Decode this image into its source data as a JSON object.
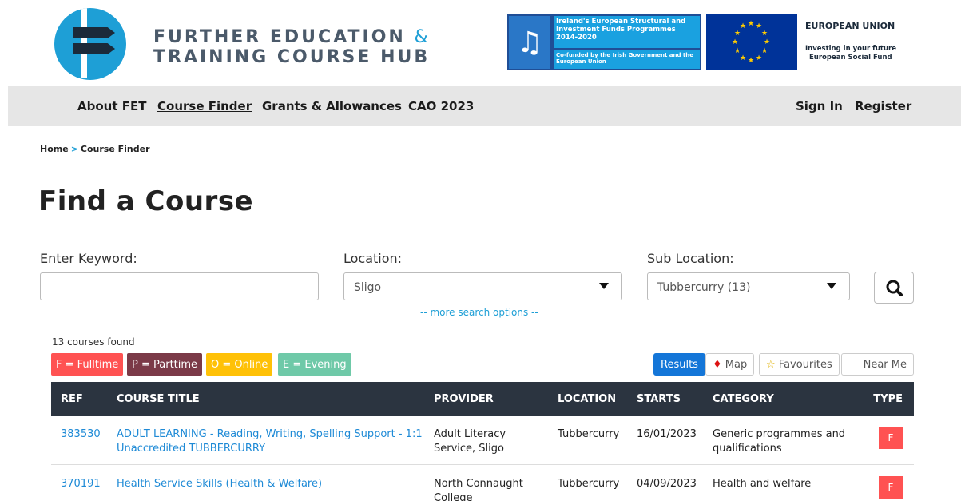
{
  "brand": {
    "line1": "FURTHER EDUCATION",
    "amp": "&",
    "line2": "TRAINING COURSE HUB"
  },
  "funding": {
    "title": "Ireland's European Structural and Investment Funds Programmes 2014-2020",
    "subtitle": "Co-funded by the Irish Government and the European Union",
    "eu_title": "EUROPEAN UNION",
    "eu_sub_1": "Investing in your future",
    "eu_sub_2": "European Social Fund"
  },
  "nav": {
    "items": [
      {
        "label": "About FET"
      },
      {
        "label": "Course Finder"
      },
      {
        "label": "Grants & Allowances"
      },
      {
        "label": "CAO 2023"
      }
    ],
    "sign_in": "Sign In",
    "register": "Register"
  },
  "breadcrumb": {
    "home": "Home",
    "sep": ">",
    "current": "Course Finder"
  },
  "page_title": "Find a Course",
  "search": {
    "keyword_label": "Enter Keyword:",
    "keyword_value": "",
    "location_label": "Location:",
    "location_value": "Sligo",
    "sublocation_label": "Sub Location:",
    "sublocation_value": "Tubbercurry (13)",
    "more_options": "-- more search options --"
  },
  "results": {
    "count": "13 courses found",
    "legend": [
      {
        "label": "F = Fulltime",
        "color": "#ff5252"
      },
      {
        "label": "P = Parttime",
        "color": "#7b3a48"
      },
      {
        "label": "O = Online",
        "color": "#ffc107"
      },
      {
        "label": "E = Evening",
        "color": "#6fc9a8"
      }
    ],
    "views": {
      "results": "Results",
      "map": "Map",
      "favourites": "Favourites",
      "near_me": "Near Me"
    },
    "columns": [
      "REF",
      "COURSE TITLE",
      "PROVIDER",
      "LOCATION",
      "STARTS",
      "CATEGORY",
      "TYPE"
    ],
    "rows": [
      {
        "ref": "383530",
        "title_1": "ADULT LEARNING - Reading, Writing, Spelling Support - 1:1",
        "title_2": "Unaccredited TUBBERCURRY",
        "provider_1": "Adult Literacy",
        "provider_2": "Service, Sligo",
        "location": "Tubbercurry",
        "starts": "16/01/2023",
        "category_1": "Generic programmes and",
        "category_2": "qualifications",
        "type": "F"
      },
      {
        "ref": "370191",
        "title_1": "Health Service Skills (Health & Welfare)",
        "title_2": "",
        "provider_1": "North Connaught",
        "provider_2": "College",
        "location": "Tubbercurry",
        "starts": "04/09/2023",
        "category_1": "Health and welfare",
        "category_2": "",
        "type": "F"
      }
    ]
  },
  "colors": {
    "accent": "#1e9fd6",
    "nav_bg": "#e6e6e6",
    "table_header": "#2b3440",
    "active_view": "#1476d8"
  }
}
